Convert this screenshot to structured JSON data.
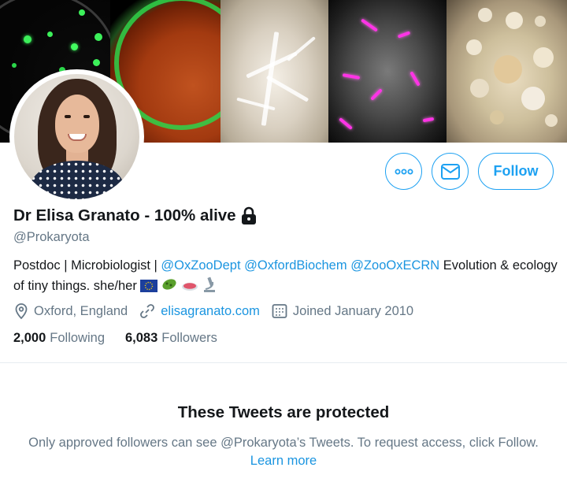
{
  "profile": {
    "name": "Dr Elisa Granato - 100% alive",
    "handle": "@Prokaryota",
    "bio_prefix": "Postdoc | Microbiologist | ",
    "bio_mentions": [
      "@OxZooDept",
      "@OxfordBiochem",
      "@ZooOxECRN"
    ],
    "bio_suffix": " Evolution & ecology of tiny things. she/her ",
    "bio_emoji": [
      "eu-flag-icon",
      "microbe-icon",
      "petri-dish-icon",
      "microscope-icon"
    ],
    "location": "Oxford, England",
    "website": "elisagranato.com",
    "joined": "Joined January 2010",
    "following_count": "2,000",
    "following_label": "Following",
    "followers_count": "6,083",
    "followers_label": "Followers"
  },
  "actions": {
    "more_icon": "more-icon",
    "message_icon": "envelope-icon",
    "follow_label": "Follow"
  },
  "protected": {
    "title": "These Tweets are protected",
    "text": "Only approved followers can see @Prokaryota’s Tweets. To request access, click Follow.",
    "learn_more": "Learn more"
  },
  "colors": {
    "accent": "#1da1f2",
    "link": "#1b95e0",
    "muted": "#657786",
    "text": "#14171a"
  }
}
